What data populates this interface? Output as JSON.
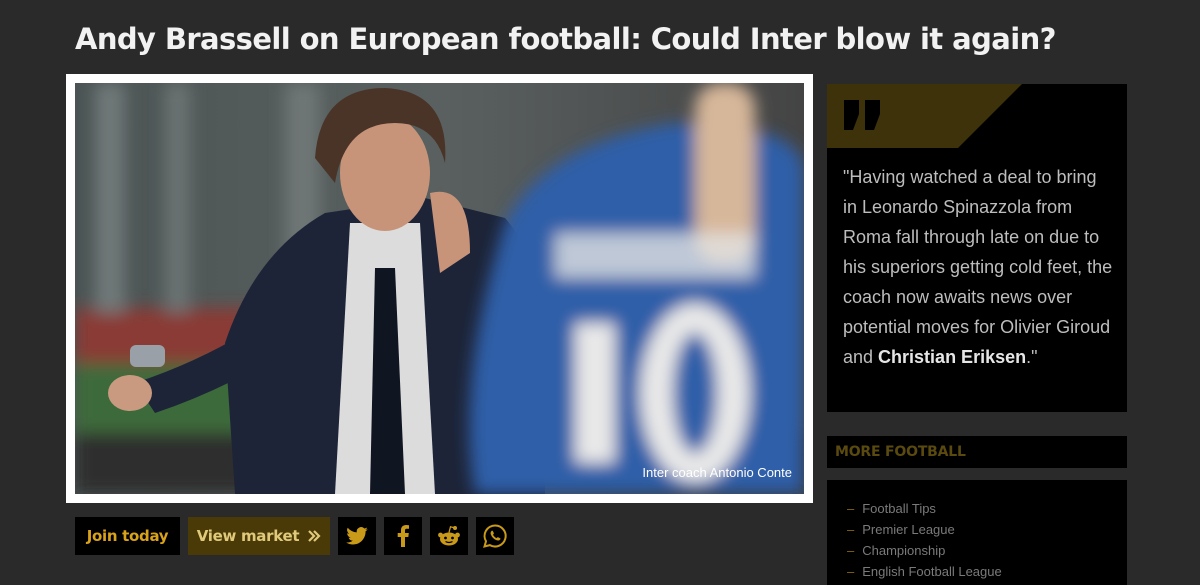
{
  "article": {
    "headline": "Andy Brassell on European football: Could Inter blow it again?",
    "image_caption": "Inter coach Antonio Conte"
  },
  "actions": {
    "join_label": "Join today",
    "market_label": "View market",
    "market_icon": "chevron-double-right-icon",
    "social": [
      "twitter-icon",
      "facebook-icon",
      "reddit-icon",
      "whatsapp-icon"
    ]
  },
  "quote": {
    "text": "\"Having watched a deal to bring in Leonardo Spinazzola from Roma fall through late on due to his superiors getting cold feet, the coach now awaits news over potential moves for Olivier Giroud and ",
    "highlight": "Christian Eriksen",
    "end": ".\""
  },
  "more_football": {
    "title": "MORE FOOTBALL",
    "items": [
      "Football Tips",
      "Premier League",
      "Championship",
      "English Football League"
    ]
  },
  "colors": {
    "background": "#2a2a2a",
    "accent_gold": "#d9a21b",
    "banner_gold": "#3e320a"
  }
}
